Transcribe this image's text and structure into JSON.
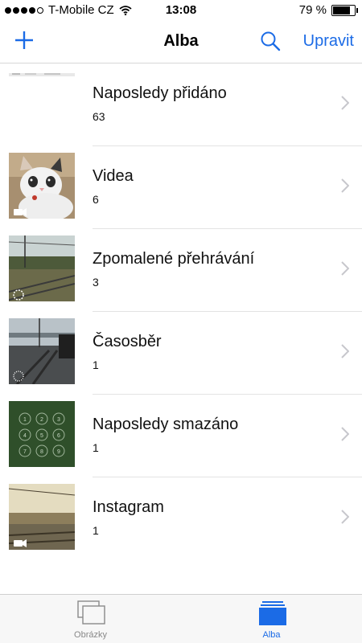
{
  "status": {
    "carrier": "T-Mobile CZ",
    "time": "13:08",
    "battery": "79 %",
    "battery_level": 0.79
  },
  "nav": {
    "title": "Alba",
    "edit_label": "Upravit"
  },
  "albums": [
    {
      "name": "Naposledy přidáno",
      "count": "63"
    },
    {
      "name": "Videa",
      "count": "6"
    },
    {
      "name": "Zpomalené přehrávání",
      "count": "3"
    },
    {
      "name": "Časosběr",
      "count": "1"
    },
    {
      "name": "Naposledy smazáno",
      "count": "1"
    },
    {
      "name": "Instagram",
      "count": "1"
    }
  ],
  "tabs": {
    "photos_label": "Obrázky",
    "albums_label": "Alba"
  },
  "colors": {
    "accent": "#1b6be6"
  }
}
